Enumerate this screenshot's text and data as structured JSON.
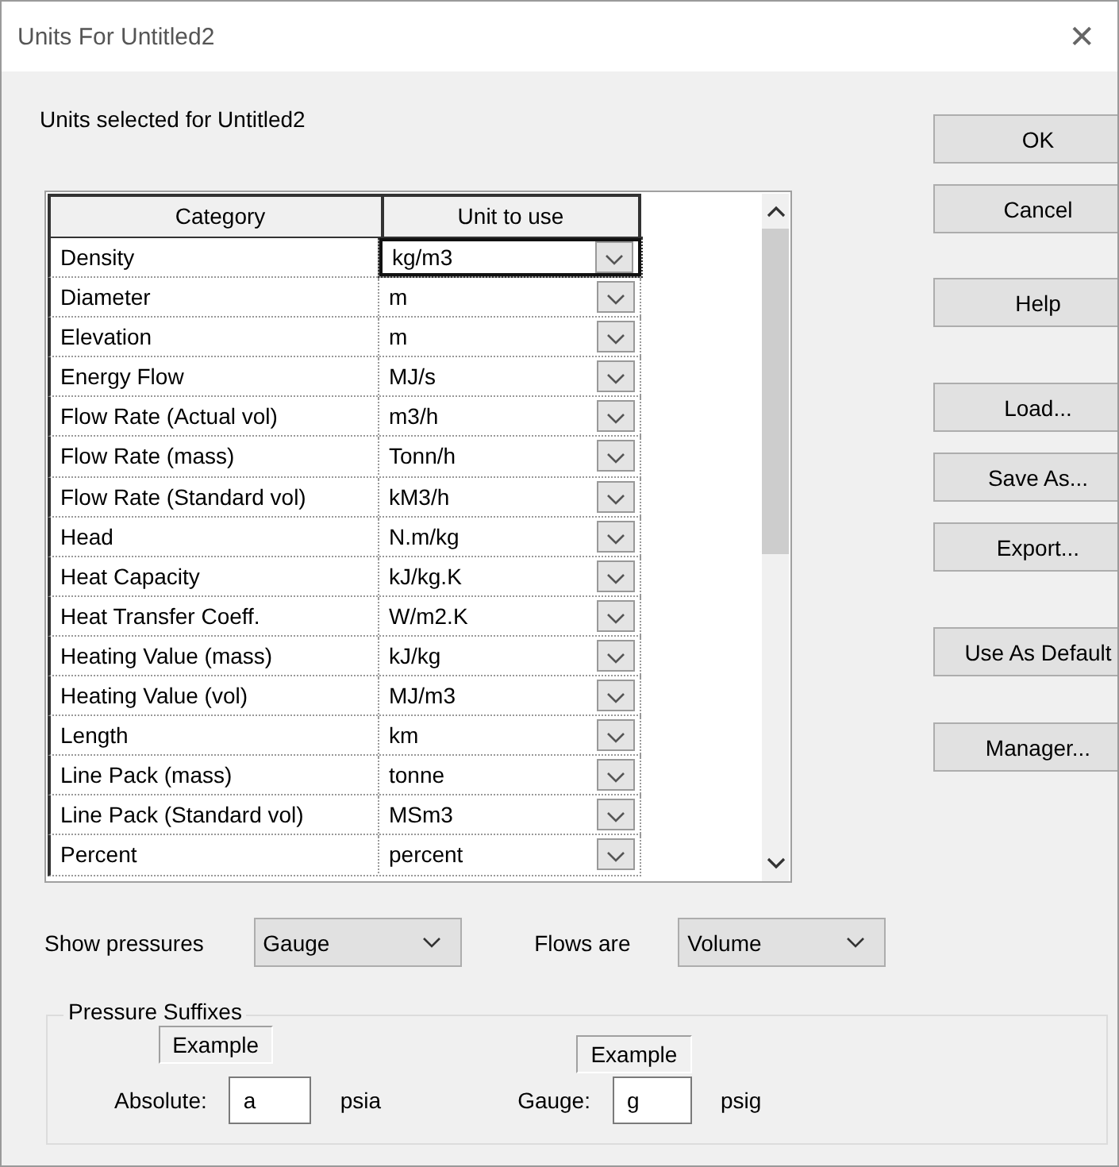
{
  "window": {
    "title": "Units For Untitled2",
    "close": "✕"
  },
  "heading": "Units selected for Untitled2",
  "table": {
    "columns": [
      "Category",
      "Unit to use"
    ],
    "rows": [
      {
        "category": "Density",
        "unit": "kg/m3",
        "selected": true
      },
      {
        "category": "Diameter",
        "unit": "m",
        "selected": false
      },
      {
        "category": "Elevation",
        "unit": "m",
        "selected": false
      },
      {
        "category": "Energy Flow",
        "unit": "MJ/s",
        "selected": false
      },
      {
        "category": "Flow Rate (Actual vol)",
        "unit": "m3/h",
        "selected": false
      },
      {
        "category": "Flow Rate (mass)",
        "unit": "Tonn/h",
        "selected": false
      },
      {
        "category": "Flow Rate (Standard vol)",
        "unit": "kM3/h",
        "selected": false
      },
      {
        "category": "Head",
        "unit": "N.m/kg",
        "selected": false
      },
      {
        "category": "Heat Capacity",
        "unit": "kJ/kg.K",
        "selected": false
      },
      {
        "category": "Heat Transfer Coeff.",
        "unit": "W/m2.K",
        "selected": false
      },
      {
        "category": "Heating Value (mass)",
        "unit": "kJ/kg",
        "selected": false
      },
      {
        "category": "Heating Value (vol)",
        "unit": "MJ/m3",
        "selected": false
      },
      {
        "category": "Length",
        "unit": "km",
        "selected": false
      },
      {
        "category": "Line Pack (mass)",
        "unit": "tonne",
        "selected": false
      },
      {
        "category": "Line Pack (Standard vol)",
        "unit": "MSm3",
        "selected": false
      },
      {
        "category": "Percent",
        "unit": "percent",
        "selected": false
      }
    ]
  },
  "buttons": [
    "OK",
    "Cancel",
    "Help",
    "Load...",
    "Save As...",
    "Export...",
    "Use As Default",
    "Manager..."
  ],
  "show_pressures": {
    "label": "Show pressures",
    "value": "Gauge"
  },
  "flows_are": {
    "label": "Flows are",
    "value": "Volume"
  },
  "pressure_suffixes": {
    "title": "Pressure Suffixes",
    "fields": [
      {
        "example": "Example",
        "label": "Absolute:",
        "value": "a",
        "unit": "psia"
      },
      {
        "example": "Example",
        "label": "Gauge:",
        "value": "g",
        "unit": "psig"
      }
    ]
  }
}
